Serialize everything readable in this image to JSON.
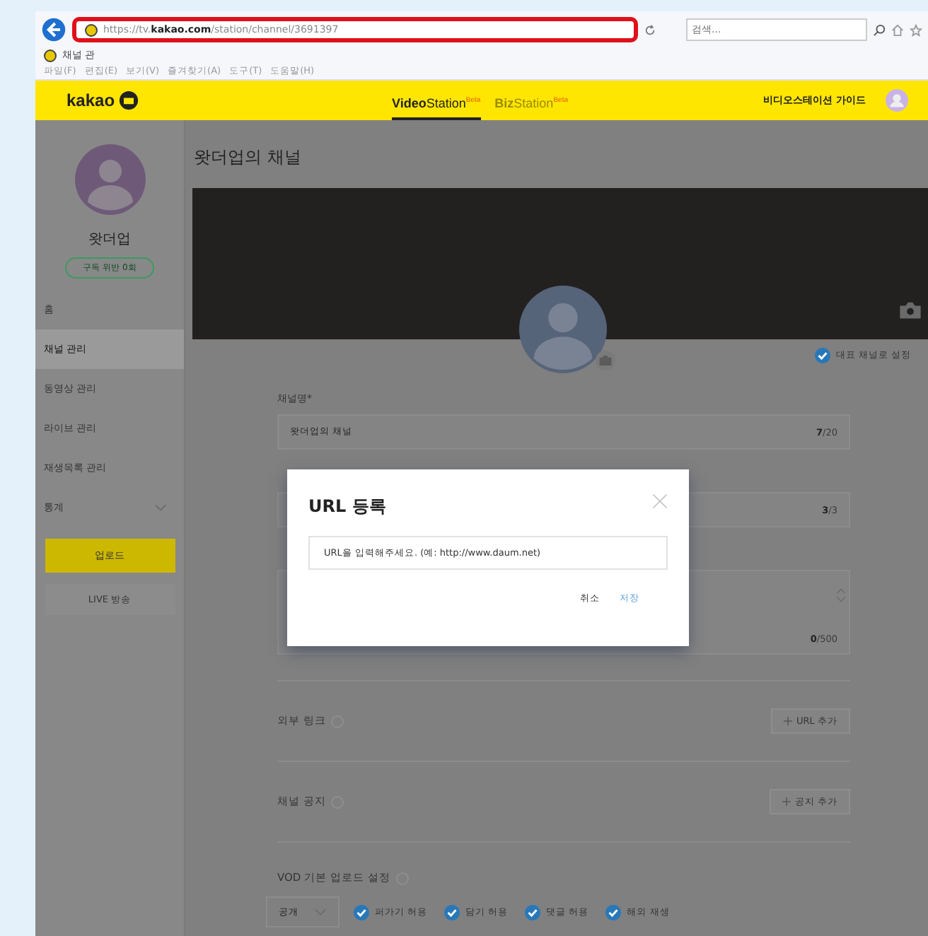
{
  "browser": {
    "url_prefix": "https://tv.",
    "url_domain": "kakao.com",
    "url_path": "/station/channel/3691397",
    "search_placeholder": "검색...",
    "tab_title": "채널 관",
    "menu": [
      "파일(F)",
      "편집(E)",
      "보기(V)",
      "즐겨찾기(A)",
      "도구(T)",
      "도움말(H)"
    ]
  },
  "header": {
    "logo": "kakao",
    "nav": [
      {
        "label": "Video",
        "label2": "Station",
        "badge": "Beta",
        "selected": true
      },
      {
        "label": "Biz",
        "label2": "Station",
        "badge": "Beta",
        "selected": false
      }
    ],
    "guide": "비디오스테이션 가이드"
  },
  "sidebar": {
    "name": "왓더업",
    "pill": "구독 위반 0회",
    "items": [
      {
        "label": "홈",
        "selected": false,
        "expandable": false
      },
      {
        "label": "채널 관리",
        "selected": true,
        "expandable": false
      },
      {
        "label": "동영상 관리",
        "selected": false,
        "expandable": false
      },
      {
        "label": "라이브 관리",
        "selected": false,
        "expandable": false
      },
      {
        "label": "재생목록 관리",
        "selected": false,
        "expandable": false
      },
      {
        "label": "통계",
        "selected": false,
        "expandable": true
      }
    ],
    "upload": "업로드",
    "live": "LIVE 방송"
  },
  "main": {
    "title": "왓더업의 채널",
    "main_channel": {
      "label": "대표 채널로 설정",
      "checked": true
    },
    "fields": [
      {
        "label": "채널명*",
        "value": "왓더업의 채널",
        "count": "7",
        "max": "/20",
        "kind": "input"
      },
      {
        "count": "3",
        "max": "/3",
        "kind": "input"
      },
      {
        "count": "0",
        "max": "/500",
        "kind": "textarea"
      }
    ],
    "sections": [
      {
        "label": "외부 링크",
        "button": "URL 추가"
      },
      {
        "label": "채널 공지",
        "button": "공지 추가"
      }
    ],
    "vod": {
      "label": "VOD 기본 업로드 설정",
      "visibility": "공개",
      "options": [
        {
          "label": "퍼가기 허용",
          "checked": true
        },
        {
          "label": "담기 허용",
          "checked": true
        },
        {
          "label": "댓글 허용",
          "checked": true
        },
        {
          "label": "해외 재생",
          "checked": true
        }
      ]
    }
  },
  "dialog": {
    "title": "URL 등록",
    "placeholder": "URL을 입력해주세요. (예: http://www.daum.net)",
    "cancel": "취소",
    "save": "저장"
  }
}
